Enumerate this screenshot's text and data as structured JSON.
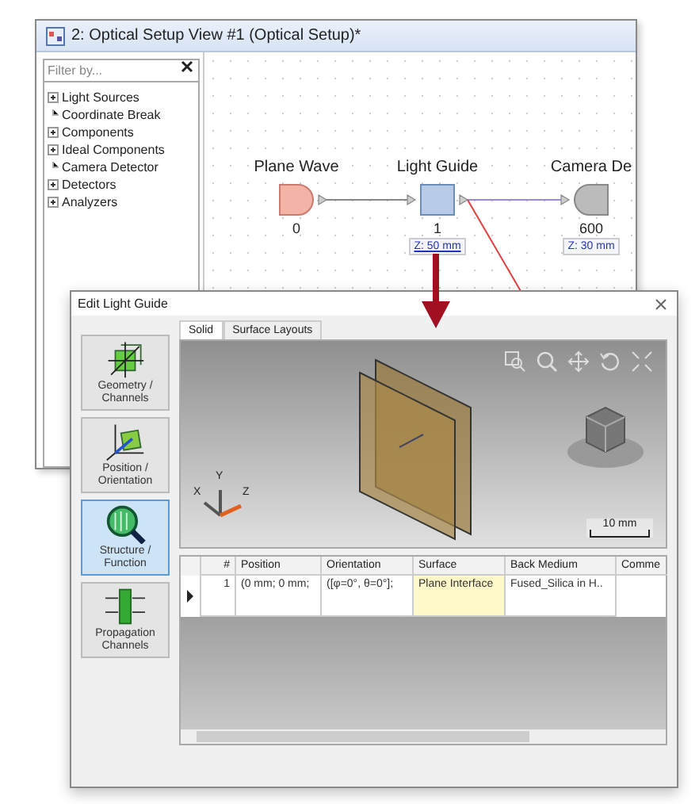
{
  "main_window": {
    "title": "2: Optical Setup View #1 (Optical Setup)*",
    "filter": {
      "placeholder": "Filter by..."
    },
    "tree": [
      {
        "label": "Light Sources",
        "kind": "group"
      },
      {
        "label": "Coordinate Break",
        "kind": "leaf"
      },
      {
        "label": "Components",
        "kind": "group"
      },
      {
        "label": "Ideal Components",
        "kind": "group"
      },
      {
        "label": "Camera Detector",
        "kind": "leaf"
      },
      {
        "label": "Detectors",
        "kind": "group"
      },
      {
        "label": "Analyzers",
        "kind": "group"
      }
    ],
    "nodes": [
      {
        "label": "Plane Wave",
        "index": "0",
        "kind": "source"
      },
      {
        "label": "Light Guide",
        "index": "1",
        "kind": "component",
        "z": "Z: 50 mm"
      },
      {
        "label": "Camera De",
        "index": "600",
        "kind": "detector",
        "z": "Z: 30 mm"
      }
    ]
  },
  "dialog": {
    "title": "Edit Light Guide",
    "nav": [
      {
        "label": "Geometry / Channels",
        "kind": "geometry",
        "selected": false
      },
      {
        "label": "Position / Orientation",
        "kind": "position",
        "selected": false
      },
      {
        "label": "Structure / Function",
        "kind": "structure",
        "selected": true
      },
      {
        "label": "Propagation Channels",
        "kind": "propagation",
        "selected": false
      }
    ],
    "tabs": [
      {
        "label": "Solid",
        "selected": true
      },
      {
        "label": "Surface Layouts",
        "selected": false
      }
    ],
    "axes": [
      "X",
      "Y",
      "Z"
    ],
    "scale": "10 mm",
    "table": {
      "columns": [
        "#",
        "Position",
        "Orientation",
        "Surface",
        "Back Medium",
        "Comme"
      ],
      "rows": [
        [
          "1",
          "(0 mm; 0 mm;",
          "([φ=0°, θ=0°];",
          "Plane Interface",
          "Fused_Silica in H.."
        ]
      ]
    }
  }
}
